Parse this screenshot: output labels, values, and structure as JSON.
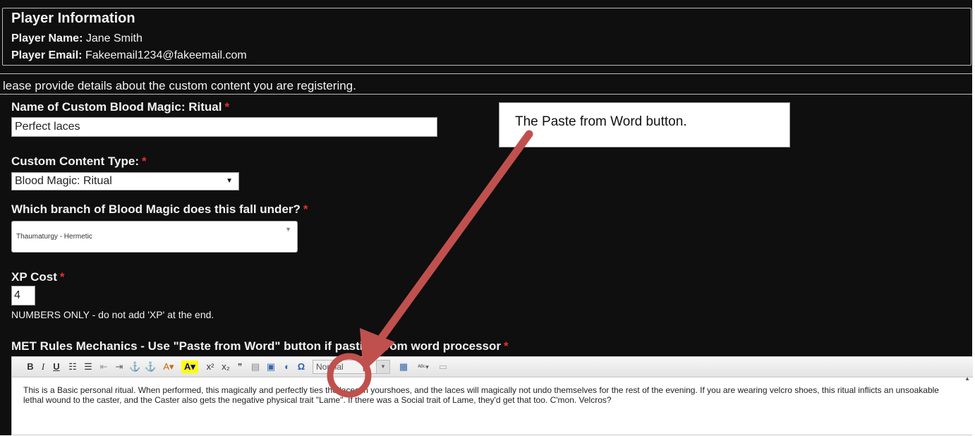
{
  "player_info": {
    "legend": "Player Information",
    "name_label": "Player Name:",
    "name_value": "Jane Smith",
    "email_label": "Player Email:",
    "email_value": "Fakeemail1234@fakeemail.com"
  },
  "instructions": "lease provide details about the custom content you are registering.",
  "fields": {
    "name": {
      "label": "Name of Custom Blood Magic: Ritual",
      "value": "Perfect laces"
    },
    "type": {
      "label": "Custom Content Type:",
      "selected": "Blood Magic: Ritual"
    },
    "branch": {
      "label": "Which branch of Blood Magic does this fall under?",
      "selected": "Thaumaturgy - Hermetic"
    },
    "xp": {
      "label": "XP Cost",
      "value": "4",
      "help": "NUMBERS ONLY - do not add 'XP' at the end."
    },
    "mechanics": {
      "label": "MET Rules Mechanics - Use \"Paste from Word\" button if pasting from word processor"
    }
  },
  "required_marker": "*",
  "editor": {
    "format_value": "Normal",
    "toolbar": [
      "bold-button",
      "italic-button",
      "underline-button",
      "numbered-list-button",
      "bulleted-list-button",
      "outdent-button",
      "indent-button",
      "link-button",
      "unlink-button",
      "text-color-button",
      "bg-color-button",
      "superscript-button",
      "subscript-button",
      "blockquote-button",
      "paste-text-button",
      "paste-from-word-button",
      "clear-format-button",
      "special-char-button",
      "format-select",
      "table-button",
      "spellcheck-button",
      "horizontal-rule-button"
    ],
    "body_text": "This is a Basic personal ritual. When performed, this magically and perfectly ties the laces in yourshoes, and the laces will magically not undo themselves for the rest of the evening.  If you are wearing velcro shoes, this ritual inflicts an unsoakable lethal wound to the caster, and the Caster also gets the negative physical trait \"Lame\".  If there was a Social trait of Lame, they'd get that too.  C'mon.  Velcros?"
  },
  "annotation": {
    "callout_text": "The Paste from Word button.",
    "color": "#c0504d"
  },
  "colors": {
    "background": "#0f0f0f",
    "required": "#e53030"
  }
}
